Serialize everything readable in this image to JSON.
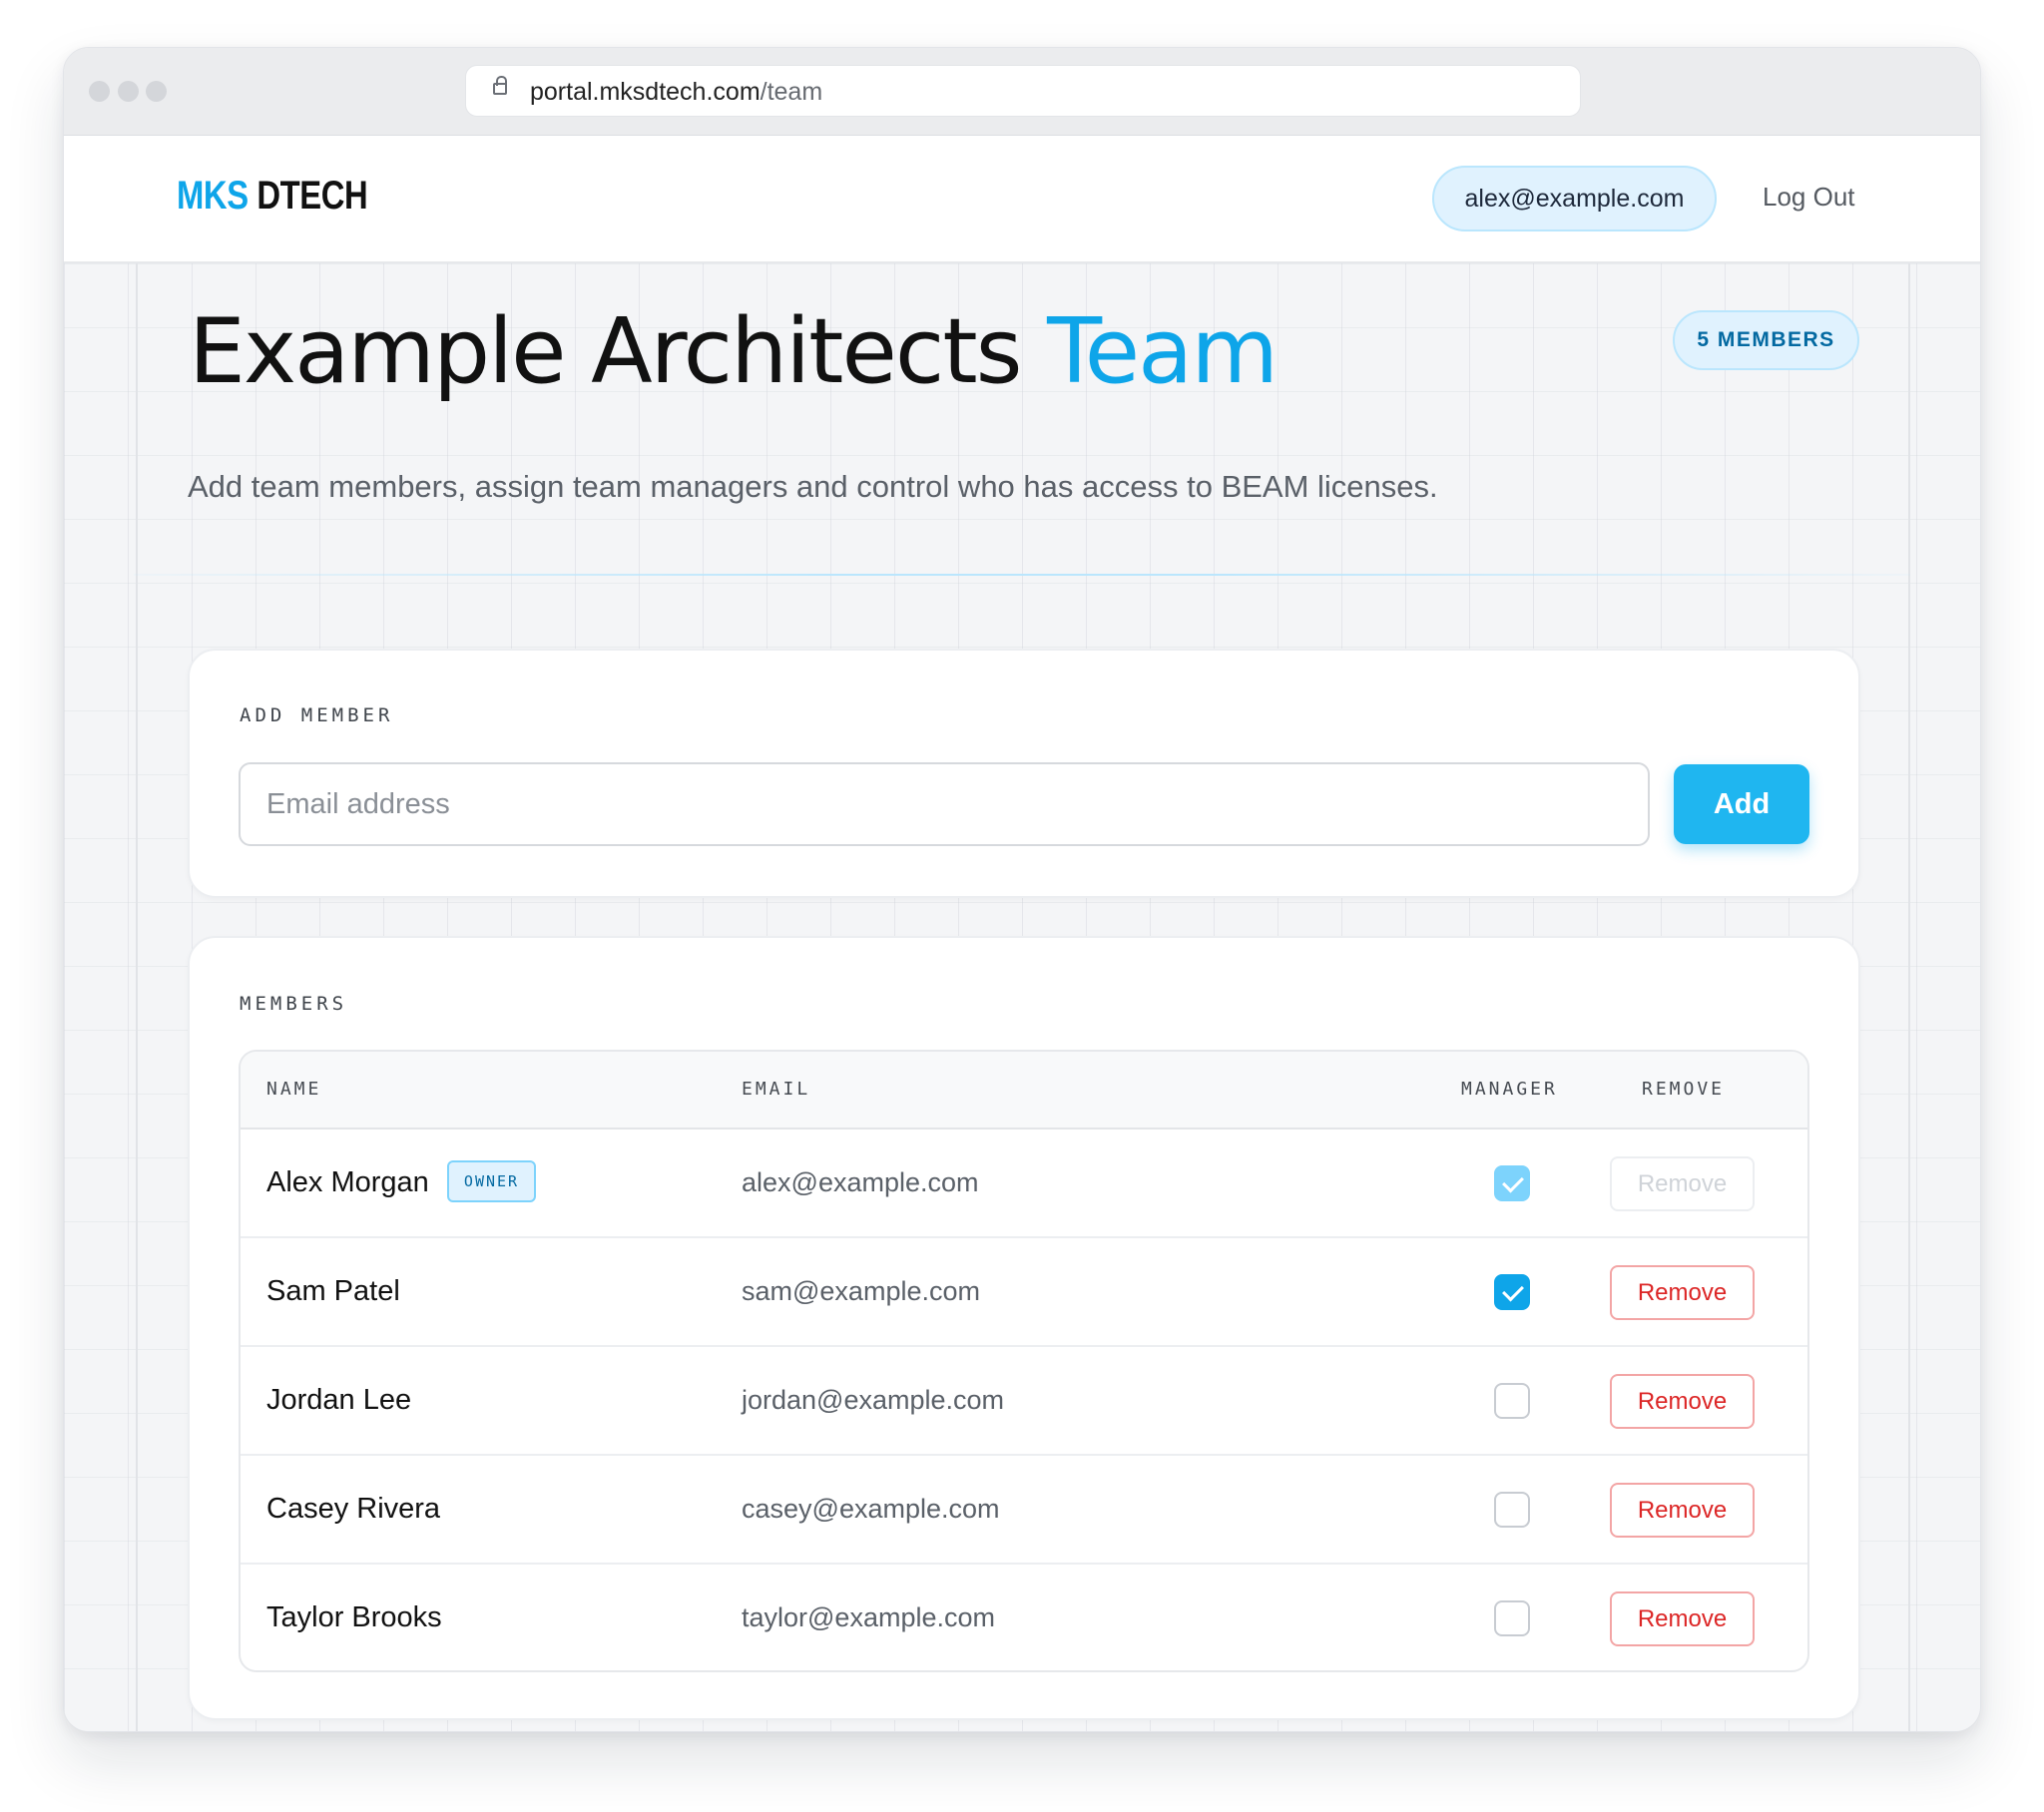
{
  "browser": {
    "url_host": "portal.mksdtech.com",
    "url_path": "/team"
  },
  "nav": {
    "logo_part1": "MKS",
    "logo_part2": "DTECH",
    "user_email": "alex@example.com",
    "logout_label": "Log Out"
  },
  "header": {
    "title_main": "Example Architects",
    "title_accent": "Team",
    "members_badge": "5 MEMBERS",
    "subtitle": "Add team members, assign team managers and control who has access to BEAM licenses."
  },
  "add_member": {
    "section_label": "ADD MEMBER",
    "email_placeholder": "Email address",
    "add_label": "Add"
  },
  "members": {
    "section_label": "MEMBERS",
    "columns": {
      "name": "NAME",
      "email": "EMAIL",
      "manager": "MANAGER",
      "remove": "REMOVE"
    },
    "owner_tag": "OWNER",
    "rows": [
      {
        "name": "Alex Morgan",
        "email": "alex@example.com",
        "manager": true,
        "owner": true,
        "remove_label": "Remove"
      },
      {
        "name": "Sam Patel",
        "email": "sam@example.com",
        "manager": true,
        "owner": false,
        "remove_label": "Remove"
      },
      {
        "name": "Jordan Lee",
        "email": "jordan@example.com",
        "manager": false,
        "owner": false,
        "remove_label": "Remove"
      },
      {
        "name": "Casey Rivera",
        "email": "casey@example.com",
        "manager": false,
        "owner": false,
        "remove_label": "Remove"
      },
      {
        "name": "Taylor Brooks",
        "email": "taylor@example.com",
        "manager": false,
        "owner": false,
        "remove_label": "Remove"
      }
    ]
  },
  "colors": {
    "accent": "#0ea5e9",
    "danger": "#dc2626"
  }
}
